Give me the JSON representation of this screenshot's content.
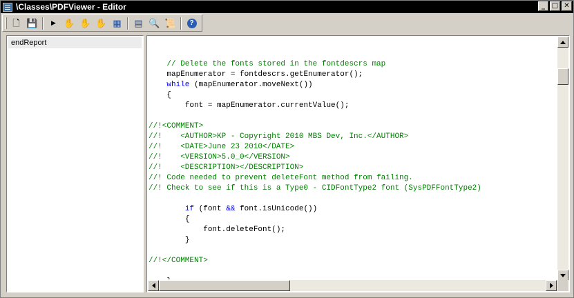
{
  "window": {
    "title": "\\Classes\\PDFViewer - Editor",
    "controls": {
      "minimize": "_",
      "maximize": "□",
      "close": "✕"
    }
  },
  "toolbar": {
    "buttons": [
      {
        "name": "new",
        "glyph": "🗋"
      },
      {
        "name": "save",
        "glyph": "💾"
      },
      {
        "name": "run",
        "glyph": "▶"
      },
      {
        "name": "breakpoint",
        "glyph": "✋"
      },
      {
        "name": "enable-breakpoint",
        "glyph": "✋"
      },
      {
        "name": "remove-breakpoints",
        "glyph": "✋"
      },
      {
        "name": "compile",
        "glyph": "▦"
      },
      {
        "name": "lookup",
        "glyph": "▤"
      },
      {
        "name": "find",
        "glyph": "🔍"
      },
      {
        "name": "scripts",
        "glyph": "📜"
      },
      {
        "name": "help",
        "glyph": "?"
      }
    ]
  },
  "methods": {
    "selected": "endReport"
  },
  "code_lines": [
    {
      "indent": "",
      "segments": []
    },
    {
      "indent": "    ",
      "segments": [
        {
          "t": "// Delete the fonts stored in the fontdescrs map",
          "c": "comment"
        }
      ]
    },
    {
      "indent": "    ",
      "segments": [
        {
          "t": "mapEnumerator = fontdescrs.getEnumerator();",
          "c": "normal"
        }
      ]
    },
    {
      "indent": "    ",
      "segments": [
        {
          "t": "while",
          "c": "kw"
        },
        {
          "t": " (mapEnumerator.moveNext())",
          "c": "normal"
        }
      ]
    },
    {
      "indent": "    ",
      "segments": [
        {
          "t": "{",
          "c": "normal"
        }
      ]
    },
    {
      "indent": "        ",
      "segments": [
        {
          "t": "font = mapEnumerator.currentValue();",
          "c": "normal"
        }
      ]
    },
    {
      "indent": "",
      "segments": []
    },
    {
      "indent": "",
      "segments": [
        {
          "t": "//!<COMMENT>",
          "c": "comment"
        }
      ]
    },
    {
      "indent": "",
      "segments": [
        {
          "t": "//!    <AUTHOR>KP - Copyright 2010 MBS Dev, Inc.</AUTHOR>",
          "c": "comment"
        }
      ]
    },
    {
      "indent": "",
      "segments": [
        {
          "t": "//!    <DATE>June 23 2010</DATE>",
          "c": "comment"
        }
      ]
    },
    {
      "indent": "",
      "segments": [
        {
          "t": "//!    <VERSION>5.0_0</VERSION>",
          "c": "comment"
        }
      ]
    },
    {
      "indent": "",
      "segments": [
        {
          "t": "//!    <DESCRIPTION></DESCRIPTION>",
          "c": "comment"
        }
      ]
    },
    {
      "indent": "",
      "segments": [
        {
          "t": "//! Code needed to prevent deleteFont method from failing.",
          "c": "comment"
        }
      ]
    },
    {
      "indent": "",
      "segments": [
        {
          "t": "//! Check to see if this is a Type0 - CIDFontType2 font (SysPDFFontType2)",
          "c": "comment"
        }
      ]
    },
    {
      "indent": "",
      "segments": []
    },
    {
      "indent": "        ",
      "segments": [
        {
          "t": "if",
          "c": "kw"
        },
        {
          "t": " (font ",
          "c": "normal"
        },
        {
          "t": "&&",
          "c": "kw"
        },
        {
          "t": " font.isUnicode())",
          "c": "normal"
        }
      ]
    },
    {
      "indent": "        ",
      "segments": [
        {
          "t": "{",
          "c": "normal"
        }
      ]
    },
    {
      "indent": "            ",
      "segments": [
        {
          "t": "font.deleteFont();",
          "c": "normal"
        }
      ]
    },
    {
      "indent": "        ",
      "segments": [
        {
          "t": "}",
          "c": "normal"
        }
      ]
    },
    {
      "indent": "",
      "segments": []
    },
    {
      "indent": "",
      "segments": [
        {
          "t": "//!</COMMENT>",
          "c": "comment"
        }
      ]
    },
    {
      "indent": "",
      "segments": []
    },
    {
      "indent": "    ",
      "segments": [
        {
          "t": "}",
          "c": "normal"
        }
      ]
    }
  ],
  "colors": {
    "comment": "#008000",
    "keyword": "#0000ff",
    "text": "#000000",
    "face": "#d4d0c8"
  }
}
